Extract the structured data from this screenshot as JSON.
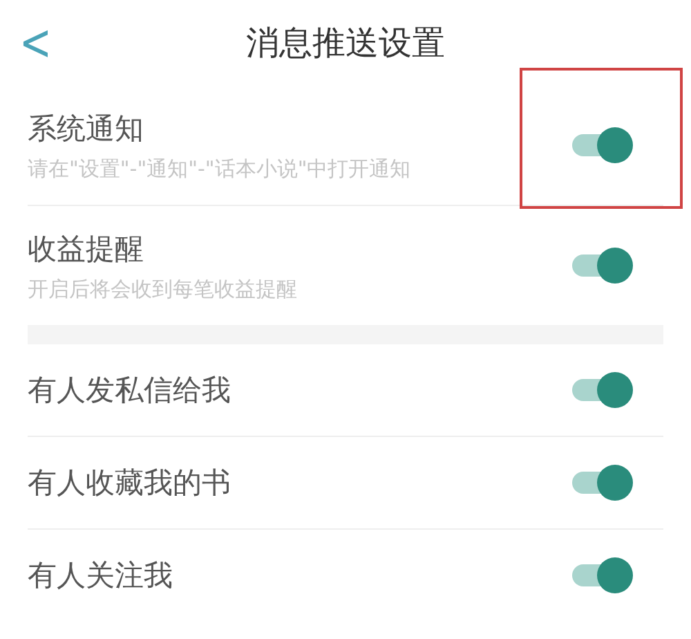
{
  "header": {
    "back": "<",
    "title": "消息推送设置"
  },
  "sections": [
    {
      "items": [
        {
          "label": "系统通知",
          "description": "请在\"设置\"-\"通知\"-\"话本小说\"中打开通知",
          "on": true,
          "highlighted": true
        },
        {
          "label": "收益提醒",
          "description": "开启后将会收到每笔收益提醒",
          "on": true,
          "highlighted": false
        }
      ]
    },
    {
      "items": [
        {
          "label": "有人发私信给我",
          "on": true,
          "highlighted": false
        },
        {
          "label": "有人收藏我的书",
          "on": true,
          "highlighted": false
        },
        {
          "label": "有人关注我",
          "on": true,
          "highlighted": false
        }
      ]
    }
  ]
}
